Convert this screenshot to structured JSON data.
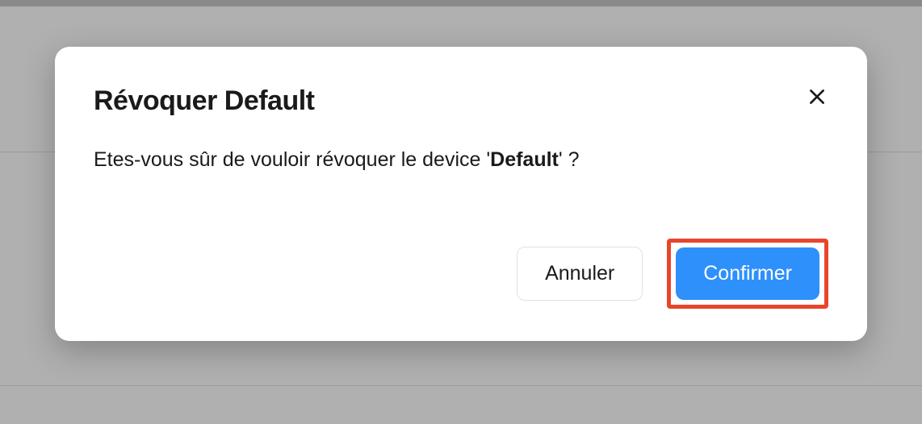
{
  "modal": {
    "title": "Révoquer Default",
    "body_prefix": "Etes-vous sûr de vouloir révoquer le device '",
    "body_bold": "Default",
    "body_suffix": "' ?",
    "cancel_label": "Annuler",
    "confirm_label": "Confirmer"
  }
}
